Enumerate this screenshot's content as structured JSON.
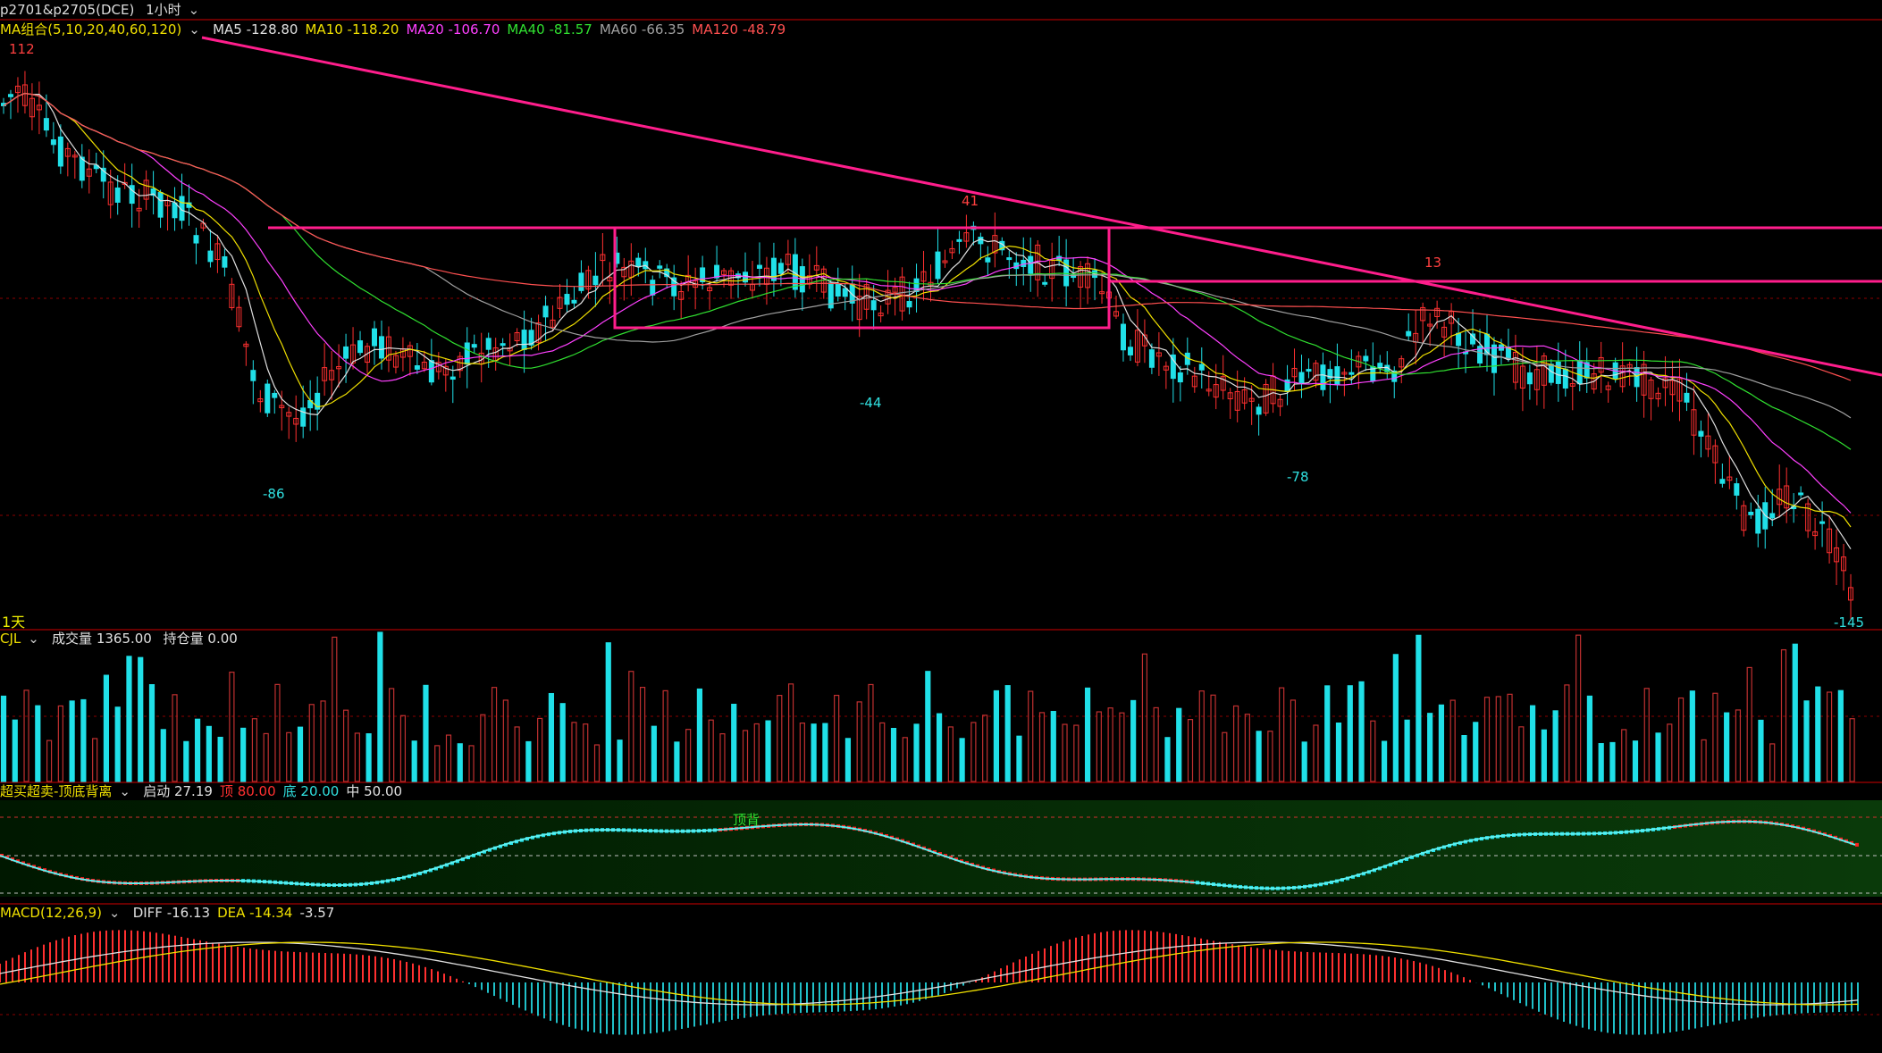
{
  "header": {
    "symbol": "p2701&p2705(DCE)",
    "period": "1小时"
  },
  "ma_bar": {
    "label": "MA组合(5,10,20,40,60,120)",
    "items": [
      {
        "text": "MA5 -128.80",
        "color": "#e0e0e0"
      },
      {
        "text": "MA10 -118.20",
        "color": "#f0e000"
      },
      {
        "text": "MA20 -106.70",
        "color": "#ff40ff"
      },
      {
        "text": "MA40 -81.57",
        "color": "#30e030"
      },
      {
        "text": "MA60 -66.35",
        "color": "#a0a0a0"
      },
      {
        "text": "MA120 -48.79",
        "color": "#ff5050"
      }
    ]
  },
  "price_labels": {
    "p112": "112",
    "p41": "41",
    "p13": "13",
    "m86": "-86",
    "m44": "-44",
    "m78": "-78",
    "m145": "-145"
  },
  "period_tag": "1天",
  "volume_bar": {
    "label": "CJL",
    "vol": "成交量 1365.00",
    "oi": "持仓量 0.00"
  },
  "osc_bar": {
    "label": "超买超卖-顶底背离",
    "items": [
      {
        "text": "启动 27.19",
        "color": "#e0e0e0"
      },
      {
        "text": "顶 80.00",
        "color": "#ff3030"
      },
      {
        "text": "底 20.00",
        "color": "#30e0e0"
      },
      {
        "text": "中 50.00",
        "color": "#e0e0e0"
      }
    ],
    "divergence_label": "顶背"
  },
  "macd_bar": {
    "label": "MACD(12,26,9)",
    "items": [
      {
        "text": "DIFF -16.13",
        "color": "#e0e0e0"
      },
      {
        "text": "DEA -14.34",
        "color": "#f0e000"
      },
      {
        "text": "-3.57",
        "color": "#e0e0e0"
      }
    ]
  },
  "colors": {
    "up": "#ff3030",
    "down": "#20e0e8",
    "trend": "#ff1e8c",
    "grid": "#8b0000"
  }
}
